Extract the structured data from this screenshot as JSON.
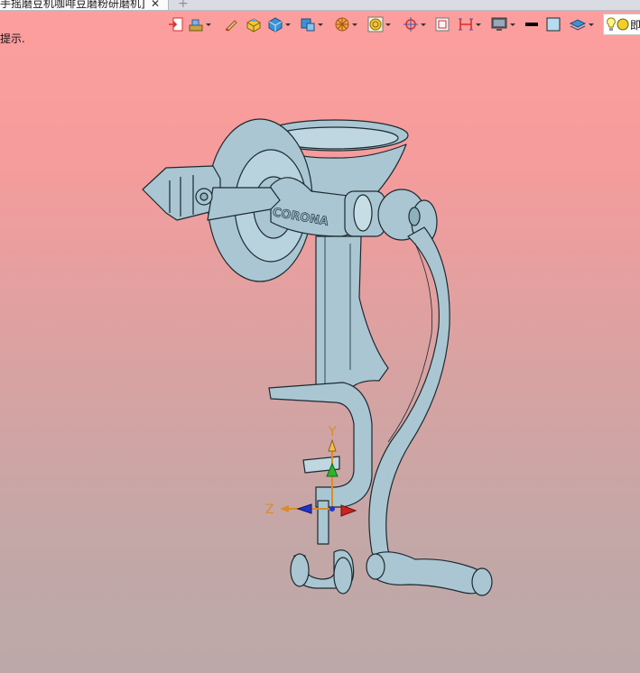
{
  "tab": {
    "title": "手摇磨豆机咖啡豆磨粉研磨机]",
    "close_glyph": "✕",
    "add_glyph": "+"
  },
  "hint_text": "提示.",
  "toolbar": {
    "icons": [
      "import-icon",
      "layer-icon",
      "pencil-icon",
      "box-solid-icon",
      "cube-icon",
      "view-cube-icon",
      "wheel-icon",
      "sphere-render-icon",
      "target-icon",
      "frame-icon",
      "bracket-icon",
      "monitor-icon",
      "line-color-icon",
      "fill-color-icon",
      "layer-stack-icon",
      "light-icon"
    ],
    "light_label": "即",
    "colors": {
      "accent_blue": "#2b78c8",
      "accent_orange": "#e7902b",
      "line_black": "#000000"
    }
  },
  "model": {
    "engraving": "CORONA",
    "axes": {
      "y_label": "Y",
      "z_label": "Z"
    },
    "colors": {
      "body": "#a9c6d2",
      "edge": "#1c2a30",
      "axis_y": "#2bb52b",
      "axis_z": "#d98c2b",
      "axis_blue": "#2233cc",
      "axis_red": "#cc2222"
    }
  }
}
